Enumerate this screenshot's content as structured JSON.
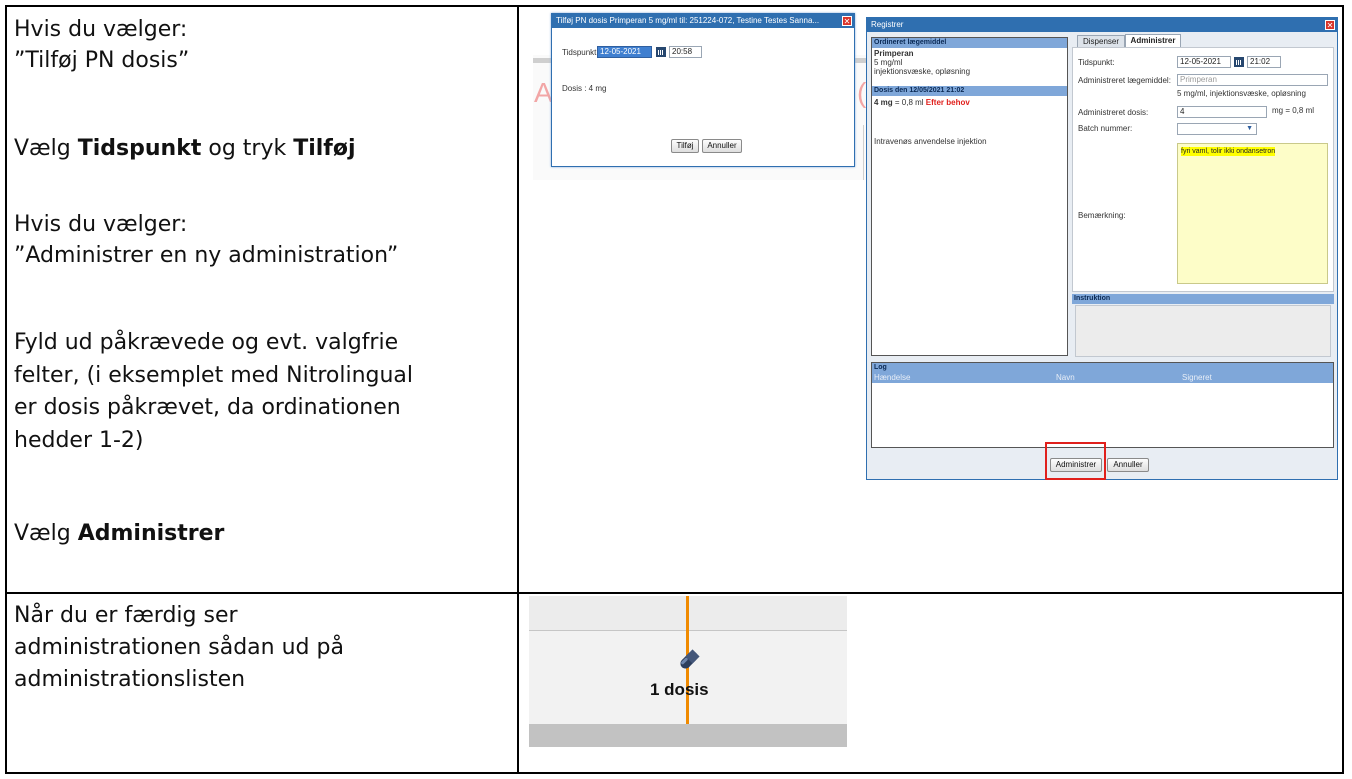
{
  "left_top": {
    "line1": "Hvis du vælger:",
    "line2": "”Tilføj PN dosis”",
    "vaelg": "Vælg ",
    "tidspunkt": "Tidspunkt",
    "og_tryk": " og tryk ",
    "tilfoej": "Tilføj",
    "line4": "Hvis du vælger:",
    "line5": " ”Administrer en ny administration”",
    "fyld1": "Fyld ud påkrævede og evt. valgfrie",
    "fyld2": "felter, (i eksemplet med Nitrolingual",
    "fyld3": "er dosis påkrævet, da ordinationen",
    "fyld4": "hedder 1-2)",
    "vaelg2": "Vælg ",
    "administrer": "Administrer"
  },
  "left_bottom": {
    "line1": "Når du er færdig ser",
    "line2": "administrationen sådan ud på",
    "line3": "administrationslisten"
  },
  "pn_dialog": {
    "title": "Tilføj PN dosis Primperan 5 mg/ml til: 251224-072, Testine Testes Sanna...",
    "tidspunkt_label": "Tidspunkt:",
    "date": "12-05-2021",
    "time": "20:58",
    "dosis": "Dosis : 4  mg",
    "add_button": "Tilføj",
    "cancel_button": "Annuller",
    "bg_letter_a": "A",
    "bg_letter_c": "("
  },
  "register_dialog": {
    "title": "Registrer",
    "ordineret_header": "Ordineret lægemiddel",
    "drug_name": "Primperan",
    "strength": "5 mg/ml",
    "form": "injektionsvæske, opløsning",
    "dosis_header": "Dosis den 12/05/2021 21:02",
    "dose_amount": "4 mg",
    "dose_eq": " = 0,8 ml ",
    "dose_flag": "Efter behov",
    "route": "Intravenøs anvendelse injektion",
    "tab_dispenser": "Dispenser",
    "tab_administrer": "Administrer",
    "tidspunkt_label": "Tidspunkt:",
    "date": "12-05-2021",
    "time": "21:02",
    "adm_drug_label": "Administreret lægemiddel:",
    "adm_drug_value": "Primperan",
    "adm_drug_form": "5 mg/ml, injektionsvæske, opløsning",
    "adm_dose_label": "Administreret dosis:",
    "adm_dose_value": "4",
    "adm_dose_unit": "mg = 0,8 ml",
    "batch_label": "Batch nummer:",
    "remark_label": "Bemærkning:",
    "remark_text": "fyri vaml, tolir ikki ondansetron",
    "instruktion_header": "Instruktion",
    "log_header": "Log",
    "log_col1": "Hændelse",
    "log_col2": "Navn",
    "log_col3": "Signeret",
    "administrer_button": "Administrer",
    "annuller_button": "Annuller"
  },
  "result": {
    "label": "1 dosis"
  },
  "colors": {
    "titlebar": "#2f6fb0",
    "highlight_box": "#e0201c",
    "remark_bg": "#fdfdc8",
    "timeline": "#f08a00",
    "section_header": "#7fa7d9"
  }
}
